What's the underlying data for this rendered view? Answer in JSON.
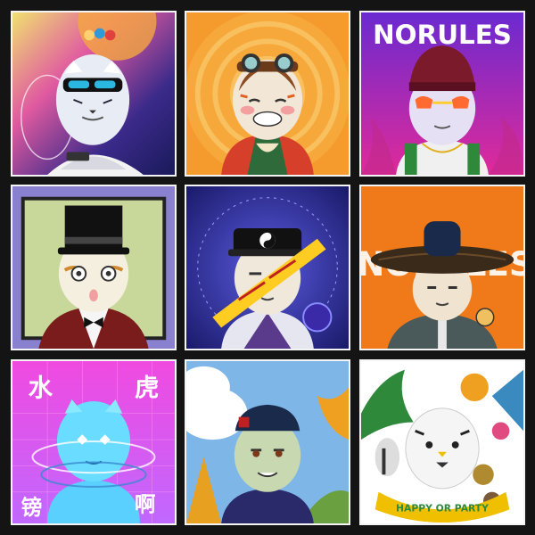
{
  "tiles": [
    {
      "id": "astronaut",
      "colors": {
        "bg": "#3b2a8a",
        "accent": "#ff9a3c"
      }
    },
    {
      "id": "aviator",
      "colors": {
        "bg": "#f08a1e",
        "accent": "#d6402a"
      }
    },
    {
      "id": "beanie",
      "colors": {
        "bg": "#8a2fd0",
        "accent": "#ff4fa0"
      },
      "brand_text": "NORULES"
    },
    {
      "id": "top-hat",
      "colors": {
        "bg": "#7b6fc8",
        "accent": "#7a1c1c"
      }
    },
    {
      "id": "taoist",
      "colors": {
        "bg": "#2a2a9a",
        "accent": "#ffcc22"
      }
    },
    {
      "id": "bamboo-hat",
      "colors": {
        "bg": "#f07a1a",
        "accent": "#3a2a1a"
      },
      "brand_text": "NORULES"
    },
    {
      "id": "water-tiger",
      "colors": {
        "bg": "#d44ad8",
        "accent": "#4ad8ff"
      },
      "title_left": "水",
      "title_right": "虎",
      "bottom_left": "镑",
      "bottom_right": "啊"
    },
    {
      "id": "autumn",
      "colors": {
        "bg": "#7fb6e8",
        "accent": "#f0a020"
      }
    },
    {
      "id": "party",
      "colors": {
        "bg": "#ffffff",
        "accent": "#f0c000"
      },
      "banner": "HAPPY OR PARTY"
    }
  ]
}
